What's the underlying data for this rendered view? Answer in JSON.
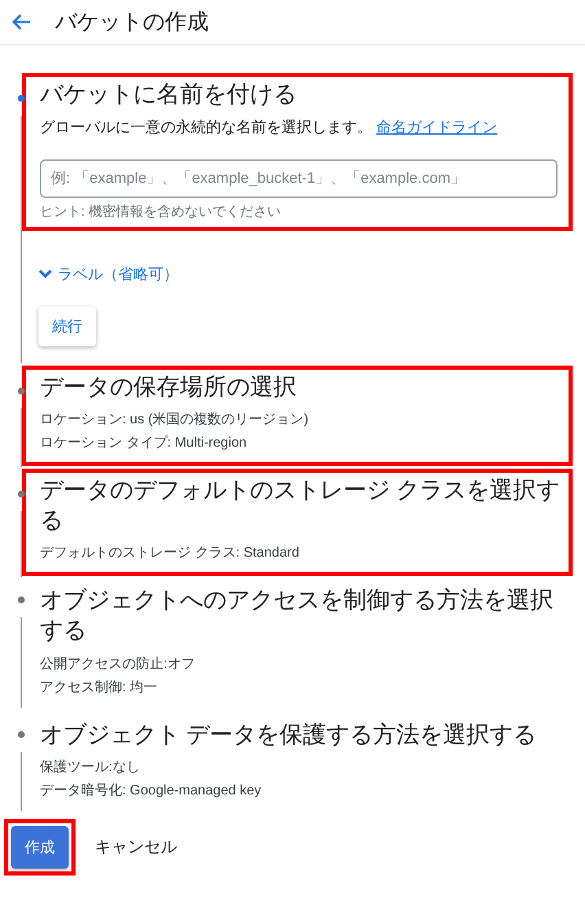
{
  "header": {
    "title": "バケットの作成"
  },
  "steps": [
    {
      "title": "バケットに名前を付ける",
      "active": true,
      "highlighted": true,
      "description": "グローバルに一意の永続的な名前を選択します。",
      "link": "命名ガイドライン",
      "field": {
        "placeholder": "例: 「example」、「example_bucket-1」、「example.com」",
        "hint": "ヒント: 機密情報を含めないでください"
      },
      "toggle": {
        "label": "ラベル（省略可）",
        "expanded": false
      },
      "button": "続行"
    },
    {
      "title": "データの保存場所の選択",
      "active": false,
      "highlighted": true,
      "details": [
        "ロケーション: us (米国の複数のリージョン)",
        "ロケーション タイプ: Multi-region"
      ]
    },
    {
      "title": "データのデフォルトのストレージ クラスを選択する",
      "active": false,
      "highlighted": true,
      "details": [
        "デフォルトのストレージ クラス: Standard"
      ]
    },
    {
      "title": "オブジェクトへのアクセスを制御する方法を選択する",
      "active": false,
      "highlighted": false,
      "details": [
        "公開アクセスの防止:オフ",
        "アクセス制御: 均一"
      ]
    },
    {
      "title": "オブジェクト データを保護する方法を選択する",
      "active": false,
      "highlighted": false,
      "details": [
        "保護ツール:なし",
        "データ暗号化: Google-managed key"
      ]
    }
  ],
  "actions": {
    "create": {
      "label": "作成",
      "highlighted": true
    },
    "cancel": {
      "label": "キャンセル"
    }
  }
}
